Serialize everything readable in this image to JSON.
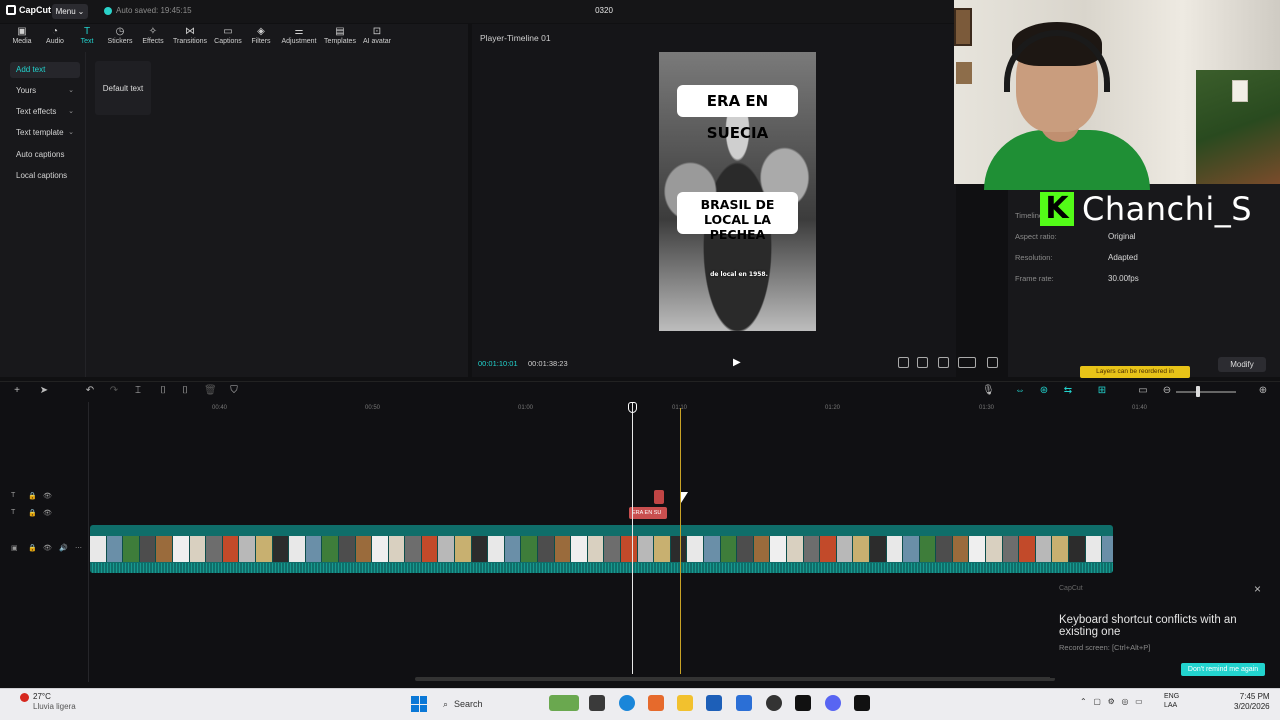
{
  "titlebar": {
    "app_name": "CapCut",
    "menu_label": "Menu",
    "autosave": "Auto saved: 19:45:15",
    "project_title": "0320"
  },
  "toolbar": {
    "items": [
      {
        "label": "Media",
        "icon": "media-icon"
      },
      {
        "label": "Audio",
        "icon": "audio-icon"
      },
      {
        "label": "Text",
        "icon": "text-icon"
      },
      {
        "label": "Stickers",
        "icon": "stickers-icon"
      },
      {
        "label": "Effects",
        "icon": "effects-icon"
      },
      {
        "label": "Transitions",
        "icon": "transitions-icon"
      },
      {
        "label": "Captions",
        "icon": "captions-icon"
      },
      {
        "label": "Filters",
        "icon": "filters-icon"
      },
      {
        "label": "Adjustment",
        "icon": "adjustment-icon"
      },
      {
        "label": "Templates",
        "icon": "templates-icon"
      },
      {
        "label": "AI avatar",
        "icon": "ai-avatar-icon"
      }
    ],
    "active": "Text"
  },
  "leftnav": {
    "items": [
      "Add text",
      "Yours",
      "Text effects",
      "Text template",
      "Auto captions",
      "Local captions"
    ]
  },
  "text_panel": {
    "default_text_card": "Default text"
  },
  "player": {
    "title": "Player-Timeline 01",
    "caption_top": "ERA EN SUECIA",
    "caption_middle": "BRASIL DE LOCAL LA PECHEA",
    "caption_bottom": "de local en 1958.",
    "current_time": "00:01:10:01",
    "total_time": "00:01:38:23"
  },
  "details": {
    "rows": [
      {
        "label": "Aspect ratio:",
        "value": "Original"
      },
      {
        "label": "Resolution:",
        "value": "Adapted"
      },
      {
        "label": "Frame rate:",
        "value": "30.00fps"
      }
    ],
    "timeline_label": "Timeline",
    "hint": "Layers can be reordered in",
    "modify_label": "Modify"
  },
  "webcam": {
    "streamer": "Chanchi_S",
    "platform_glyph": "K"
  },
  "timeline": {
    "ticks": [
      "00:40",
      "00:50",
      "01:00",
      "01:10",
      "01:20",
      "01:30",
      "01:40"
    ],
    "text_clip_label": "ERA EN SU",
    "zoom": 0.42
  },
  "toast": {
    "app": "CapCut",
    "message": "Keyboard shortcut conflicts with an existing one",
    "detail": "Record screen: [Ctrl+Alt+P]",
    "button": "Don't remind me again"
  },
  "taskbar": {
    "weather_temp": "27°C",
    "weather_desc": "Lluvia ligera",
    "search_label": "Search",
    "lang_top": "ENG",
    "lang_bottom": "LAA",
    "time": "7:45 PM",
    "date": "3/20/2026"
  },
  "colors": {
    "accent": "#22d3ce",
    "track": "#0f6e6a",
    "text_clip": "#c94f4f",
    "kick_green": "#53fc18"
  }
}
